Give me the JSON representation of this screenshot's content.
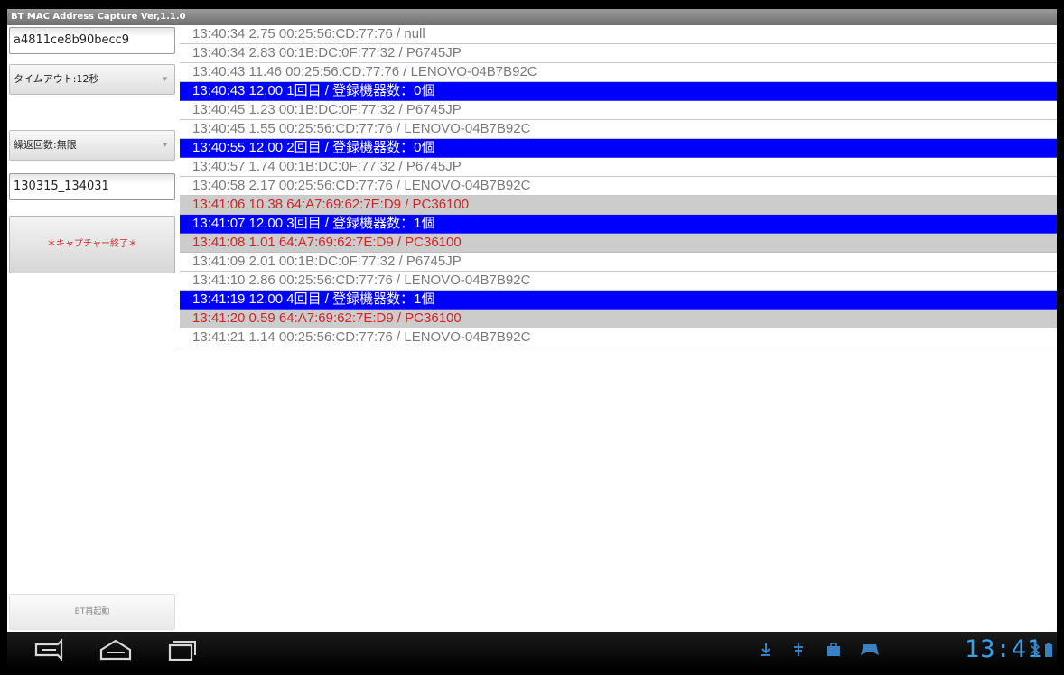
{
  "app": {
    "title": "BT MAC Address Capture Ver,1.1.0"
  },
  "sidebar": {
    "device_id": "a4811ce8b90becc9",
    "timeout_label": "タイムアウト:12秒",
    "repeat_label": "繰返回数:無限",
    "filename": "130315_134031",
    "capture_button": "＊キャプチャー終了＊",
    "restart_button": "BT再起動"
  },
  "log_rows": [
    {
      "type": "normal",
      "text": "13:40:34  2.75  00:25:56:CD:77:76  /  null"
    },
    {
      "type": "normal",
      "text": "13:40:34  2.83  00:1B:DC:0F:77:32  /  P6745JP"
    },
    {
      "type": "normal",
      "text": "13:40:43  11.46  00:25:56:CD:77:76  /  LENOVO-04B7B92C"
    },
    {
      "type": "sep",
      "text": "13:40:43  12.00  1回目  /  登録機器数：0個"
    },
    {
      "type": "normal",
      "text": "13:40:45  1.23  00:1B:DC:0F:77:32  /  P6745JP"
    },
    {
      "type": "normal",
      "text": "13:40:45  1.55  00:25:56:CD:77:76  /  LENOVO-04B7B92C"
    },
    {
      "type": "sep",
      "text": "13:40:55  12.00  2回目  /  登録機器数：0個"
    },
    {
      "type": "normal",
      "text": "13:40:57  1.74  00:1B:DC:0F:77:32  /  P6745JP"
    },
    {
      "type": "normal",
      "text": "13:40:58  2.17  00:25:56:CD:77:76  /  LENOVO-04B7B92C"
    },
    {
      "type": "known",
      "text": "13:41:06  10.38  64:A7:69:62:7E:D9  /  PC36100"
    },
    {
      "type": "sep",
      "text": "13:41:07  12.00  3回目  /  登録機器数：1個"
    },
    {
      "type": "known",
      "text": "13:41:08  1.01  64:A7:69:62:7E:D9  /  PC36100"
    },
    {
      "type": "normal",
      "text": "13:41:09  2.01  00:1B:DC:0F:77:32  /  P6745JP"
    },
    {
      "type": "normal",
      "text": "13:41:10  2.86  00:25:56:CD:77:76  /  LENOVO-04B7B92C"
    },
    {
      "type": "sep",
      "text": "13:41:19  12.00  4回目  /  登録機器数：1個"
    },
    {
      "type": "known",
      "text": "13:41:20  0.59  64:A7:69:62:7E:D9  /  PC36100"
    },
    {
      "type": "normal",
      "text": "13:41:21  1.14  00:25:56:CD:77:76  /  LENOVO-04B7B92C"
    }
  ],
  "statusbar": {
    "time": "13:41",
    "icons": [
      "download-icon",
      "usb-icon",
      "bag-icon",
      "gamepad-icon",
      "bluetooth-icon",
      "battery-icon"
    ]
  },
  "navbar": {
    "icons": [
      "back-icon",
      "home-icon",
      "recent-apps-icon"
    ]
  },
  "colors": {
    "separator_row": "#0000ff",
    "known_device_row_bg": "#cccccc",
    "known_device_text": "#d42424",
    "normal_text": "#7a7a7a",
    "clock": "#3aa0e8"
  }
}
